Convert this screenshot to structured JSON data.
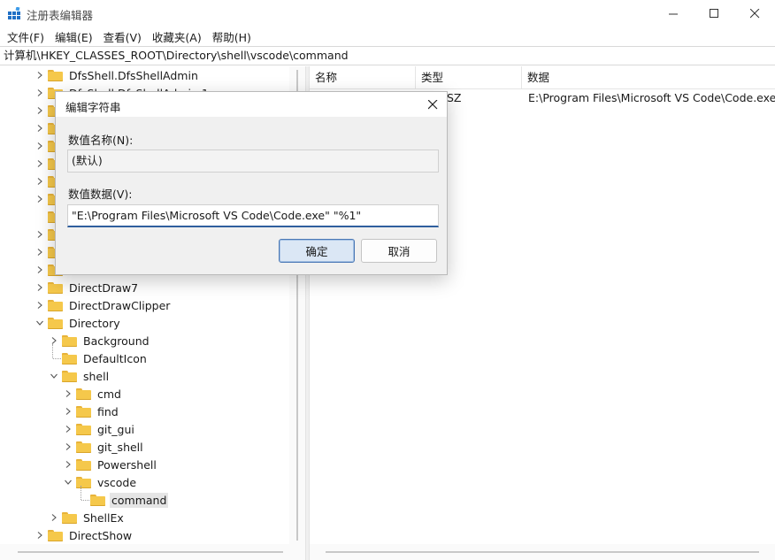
{
  "window": {
    "title": "注册表编辑器"
  },
  "menu": [
    "文件(F)",
    "编辑(E)",
    "查看(V)",
    "收藏夹(A)",
    "帮助(H)"
  ],
  "address": "计算机\\HKEY_CLASSES_ROOT\\Directory\\shell\\vscode\\command",
  "tree": {
    "items": [
      {
        "label": "DfsShell.DfsShellAdmin",
        "level": 0,
        "expander": "collapsed"
      },
      {
        "label": "DfsShell.DfsShellAdmin.1",
        "level": 0,
        "expander": "collapsed"
      },
      {
        "label": "",
        "level": 0,
        "expander": "collapsed"
      },
      {
        "label": "",
        "level": 0,
        "expander": "collapsed"
      },
      {
        "label": "",
        "level": 0,
        "expander": "collapsed"
      },
      {
        "label": "",
        "level": 0,
        "expander": "collapsed"
      },
      {
        "label": "",
        "level": 0,
        "expander": "collapsed"
      },
      {
        "label": "",
        "level": 0,
        "expander": "collapsed"
      },
      {
        "label": "",
        "level": 0,
        "expander": "none"
      },
      {
        "label": "",
        "level": 0,
        "expander": "collapsed"
      },
      {
        "label": "",
        "level": 0,
        "expander": "collapsed"
      },
      {
        "label": "",
        "level": 0,
        "expander": "collapsed"
      },
      {
        "label": "DirectDraw7",
        "level": 0,
        "expander": "collapsed"
      },
      {
        "label": "DirectDrawClipper",
        "level": 0,
        "expander": "collapsed"
      },
      {
        "label": "Directory",
        "level": 0,
        "expander": "expanded"
      },
      {
        "label": "Background",
        "level": 1,
        "expander": "collapsed"
      },
      {
        "label": "DefaultIcon",
        "level": 1,
        "expander": "none"
      },
      {
        "label": "shell",
        "level": 1,
        "expander": "expanded"
      },
      {
        "label": "cmd",
        "level": 2,
        "expander": "collapsed"
      },
      {
        "label": "find",
        "level": 2,
        "expander": "collapsed"
      },
      {
        "label": "git_gui",
        "level": 2,
        "expander": "collapsed"
      },
      {
        "label": "git_shell",
        "level": 2,
        "expander": "collapsed"
      },
      {
        "label": "Powershell",
        "level": 2,
        "expander": "collapsed"
      },
      {
        "label": "vscode",
        "level": 2,
        "expander": "expanded"
      },
      {
        "label": "command",
        "level": 3,
        "expander": "none",
        "selected": true
      },
      {
        "label": "ShellEx",
        "level": 1,
        "expander": "collapsed"
      },
      {
        "label": "DirectShow",
        "level": 0,
        "expander": "collapsed"
      }
    ]
  },
  "list": {
    "headers": {
      "name": "名称",
      "type": "类型",
      "data": "数据"
    },
    "rows": [
      {
        "name": "",
        "type": "SZ",
        "data": "E:\\Program Files\\Microsoft VS Code\\Code.exe"
      }
    ]
  },
  "dialog": {
    "title": "编辑字符串",
    "name_label": "数值名称(N):",
    "name_value": "(默认)",
    "data_label": "数值数据(V):",
    "data_value": "\"E:\\Program Files\\Microsoft VS Code\\Code.exe\" \"%1\"",
    "ok_label": "确定",
    "cancel_label": "取消"
  }
}
